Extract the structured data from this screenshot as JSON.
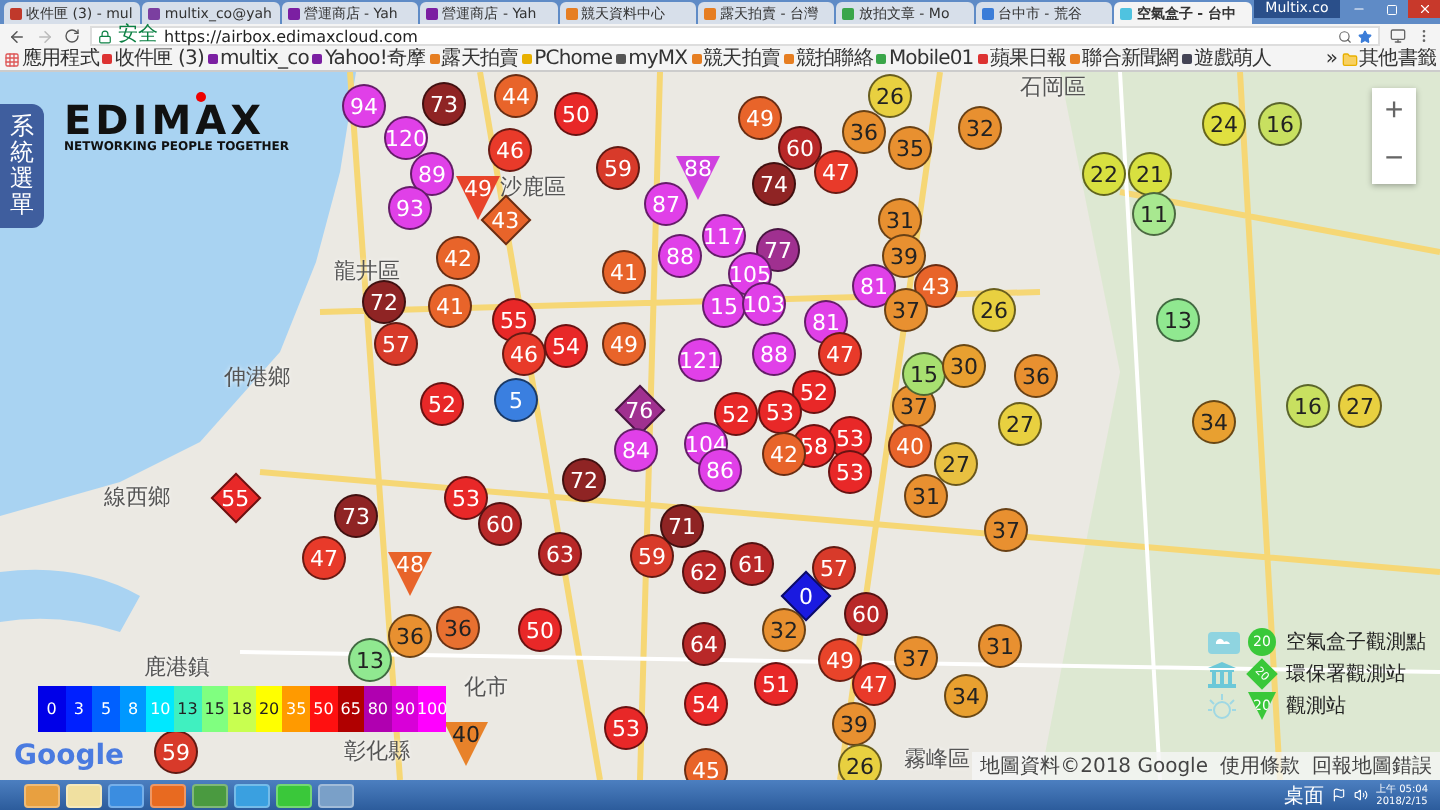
{
  "tabs": [
    {
      "label": "收件匣 (3) - mul",
      "selected": false
    },
    {
      "label": "multix_co@yah",
      "selected": false
    },
    {
      "label": "營運商店 - Yah",
      "selected": false
    },
    {
      "label": "營運商店 - Yah",
      "selected": false
    },
    {
      "label": "競天資料中心",
      "selected": false
    },
    {
      "label": "露天拍賣 - 台灣",
      "selected": false
    },
    {
      "label": "放拍文章 - Mo",
      "selected": false
    },
    {
      "label": "台中市 - 荒谷",
      "selected": false
    },
    {
      "label": "空氣盒子 - 台中",
      "selected": true
    }
  ],
  "user_badge": "Multix.co",
  "address": {
    "security": "安全",
    "url": "https://airbox.edimaxcloud.com"
  },
  "bookmarks": [
    "應用程式",
    "收件匣 (3)",
    "multix_co",
    "Yahoo!奇摩",
    "露天拍賣",
    "PChome",
    "myMX",
    "競天拍賣",
    "競拍聯絡",
    "Mobile01",
    "蘋果日報",
    "聯合新聞網",
    "遊戲萌人"
  ],
  "bookmarks_more": "»",
  "bookmarks_other": "其他書籤",
  "side_menu": "系統選單",
  "logo": {
    "name": "EDIMAX",
    "tagline": "NETWORKING PEOPLE TOGETHER"
  },
  "zoom": [
    "+",
    "−"
  ],
  "places": [
    "沙鹿區",
    "龍井區",
    "伸港鄉",
    "線西鄉",
    "鹿港鎮",
    "化市",
    "彰化縣",
    "霧峰區",
    "石岡區"
  ],
  "markers": [
    {
      "value": "94",
      "kind": "circle",
      "color": "#e040e8"
    },
    {
      "value": "73",
      "kind": "circle",
      "color": "#8f2424"
    },
    {
      "value": "120",
      "kind": "circle",
      "color": "#e040e8"
    },
    {
      "value": "89",
      "kind": "circle",
      "color": "#e040e8"
    },
    {
      "value": "93",
      "kind": "circle",
      "color": "#e040e8"
    },
    {
      "value": "49",
      "kind": "triangle",
      "color": "#e8442a"
    },
    {
      "value": "42",
      "kind": "circle",
      "color": "#e8642a"
    },
    {
      "value": "44",
      "kind": "circle",
      "color": "#e8642a"
    },
    {
      "value": "46",
      "kind": "circle",
      "color": "#e83a2a"
    },
    {
      "value": "50",
      "kind": "circle",
      "color": "#e82828"
    },
    {
      "value": "59",
      "kind": "circle",
      "color": "#d83a2a"
    },
    {
      "value": "88",
      "kind": "triangle",
      "color": "#d040e0"
    },
    {
      "value": "87",
      "kind": "circle",
      "color": "#e040e8"
    },
    {
      "value": "88",
      "kind": "circle",
      "color": "#e040e8"
    },
    {
      "value": "117",
      "kind": "circle",
      "color": "#e040e8"
    },
    {
      "value": "74",
      "kind": "circle",
      "color": "#8f2424"
    },
    {
      "value": "77",
      "kind": "circle",
      "color": "#a03090"
    },
    {
      "value": "49",
      "kind": "circle",
      "color": "#e8642a"
    },
    {
      "value": "60",
      "kind": "circle",
      "color": "#b82828"
    },
    {
      "value": "47",
      "kind": "circle",
      "color": "#e83a2a"
    },
    {
      "value": "26",
      "kind": "circle",
      "color": "#e8d040"
    },
    {
      "value": "36",
      "kind": "circle",
      "color": "#e89030"
    },
    {
      "value": "35",
      "kind": "circle",
      "color": "#e89030"
    },
    {
      "value": "32",
      "kind": "circle",
      "color": "#e89030"
    },
    {
      "value": "31",
      "kind": "circle",
      "color": "#e89030"
    },
    {
      "value": "39",
      "kind": "circle",
      "color": "#e89030"
    },
    {
      "value": "43",
      "kind": "circle",
      "color": "#e8642a"
    },
    {
      "value": "81",
      "kind": "circle",
      "color": "#e040e8"
    },
    {
      "value": "37",
      "kind": "circle",
      "color": "#e89030"
    },
    {
      "value": "43",
      "kind": "diamond",
      "color": "#e8642a"
    },
    {
      "value": "41",
      "kind": "circle",
      "color": "#e8642a"
    },
    {
      "value": "105",
      "kind": "circle",
      "color": "#e040e8"
    },
    {
      "value": "15",
      "kind": "circle",
      "color": "#e040e8"
    },
    {
      "value": "103",
      "kind": "circle",
      "color": "#e040e8"
    },
    {
      "value": "55",
      "kind": "circle",
      "color": "#e82828"
    },
    {
      "value": "46",
      "kind": "circle",
      "color": "#e83a2a"
    },
    {
      "value": "54",
      "kind": "circle",
      "color": "#e82828"
    },
    {
      "value": "49",
      "kind": "circle",
      "color": "#e8642a"
    },
    {
      "value": "5",
      "kind": "circle",
      "color": "#3a7fe0"
    },
    {
      "value": "121",
      "kind": "circle",
      "color": "#e040e8"
    },
    {
      "value": "88",
      "kind": "circle",
      "color": "#e040e8"
    },
    {
      "value": "81",
      "kind": "circle",
      "color": "#e040e8"
    },
    {
      "value": "47",
      "kind": "circle",
      "color": "#e83a2a"
    },
    {
      "value": "76",
      "kind": "diamond",
      "color": "#a03090"
    },
    {
      "value": "52",
      "kind": "circle",
      "color": "#e82828"
    },
    {
      "value": "52",
      "kind": "circle",
      "color": "#e82828"
    },
    {
      "value": "53",
      "kind": "circle",
      "color": "#e82828"
    },
    {
      "value": "84",
      "kind": "circle",
      "color": "#e040e8"
    },
    {
      "value": "104",
      "kind": "circle",
      "color": "#e040e8"
    },
    {
      "value": "86",
      "kind": "circle",
      "color": "#e040e8"
    },
    {
      "value": "53",
      "kind": "circle",
      "color": "#e82828"
    },
    {
      "value": "58",
      "kind": "circle",
      "color": "#e82828"
    },
    {
      "value": "42",
      "kind": "circle",
      "color": "#e8642a"
    },
    {
      "value": "53",
      "kind": "circle",
      "color": "#e82828"
    },
    {
      "value": "37",
      "kind": "circle",
      "color": "#e89030"
    },
    {
      "value": "40",
      "kind": "circle",
      "color": "#e8642a"
    },
    {
      "value": "15",
      "kind": "circle",
      "color": "#a8e070"
    },
    {
      "value": "72",
      "kind": "circle",
      "color": "#8f2424"
    },
    {
      "value": "41",
      "kind": "circle",
      "color": "#e8642a"
    },
    {
      "value": "57",
      "kind": "circle",
      "color": "#d83a2a"
    },
    {
      "value": "52",
      "kind": "circle",
      "color": "#e82828"
    },
    {
      "value": "72",
      "kind": "circle",
      "color": "#8f2424"
    },
    {
      "value": "73",
      "kind": "circle",
      "color": "#8f2424"
    },
    {
      "value": "53",
      "kind": "circle",
      "color": "#e82828"
    },
    {
      "value": "60",
      "kind": "circle",
      "color": "#b82828"
    },
    {
      "value": "55",
      "kind": "diamond",
      "color": "#e82828"
    },
    {
      "value": "47",
      "kind": "circle",
      "color": "#e83a2a"
    },
    {
      "value": "48",
      "kind": "triangle",
      "color": "#e8642a"
    },
    {
      "value": "63",
      "kind": "circle",
      "color": "#b82828"
    },
    {
      "value": "59",
      "kind": "circle",
      "color": "#d83a2a"
    },
    {
      "value": "71",
      "kind": "circle",
      "color": "#8f2424"
    },
    {
      "value": "62",
      "kind": "circle",
      "color": "#b82828"
    },
    {
      "value": "61",
      "kind": "circle",
      "color": "#b82828"
    },
    {
      "value": "57",
      "kind": "circle",
      "color": "#d83a2a"
    },
    {
      "value": "0",
      "kind": "diamond",
      "color": "#1a1ae0"
    },
    {
      "value": "32",
      "kind": "circle",
      "color": "#e89030"
    },
    {
      "value": "51",
      "kind": "circle",
      "color": "#e82828"
    },
    {
      "value": "49",
      "kind": "circle",
      "color": "#e8442a"
    },
    {
      "value": "60",
      "kind": "circle",
      "color": "#b82828"
    },
    {
      "value": "37",
      "kind": "circle",
      "color": "#e89030"
    },
    {
      "value": "47",
      "kind": "circle",
      "color": "#e83a2a"
    },
    {
      "value": "39",
      "kind": "circle",
      "color": "#e89030"
    },
    {
      "value": "26",
      "kind": "circle",
      "color": "#e8d040"
    },
    {
      "value": "31",
      "kind": "circle",
      "color": "#e89030"
    },
    {
      "value": "34",
      "kind": "circle",
      "color": "#e8a030"
    },
    {
      "value": "50",
      "kind": "circle",
      "color": "#e82828"
    },
    {
      "value": "64",
      "kind": "circle",
      "color": "#b82828"
    },
    {
      "value": "54",
      "kind": "circle",
      "color": "#e82828"
    },
    {
      "value": "53",
      "kind": "circle",
      "color": "#e82828"
    },
    {
      "value": "45",
      "kind": "circle",
      "color": "#e8642a"
    },
    {
      "value": "36",
      "kind": "circle",
      "color": "#e89030"
    },
    {
      "value": "36",
      "kind": "circle",
      "color": "#e87030"
    },
    {
      "value": "13",
      "kind": "circle",
      "color": "#90e890"
    },
    {
      "value": "59",
      "kind": "circle",
      "color": "#d83a2a"
    },
    {
      "value": "31",
      "kind": "circle",
      "color": "#e89030"
    },
    {
      "value": "37",
      "kind": "circle",
      "color": "#e89030"
    },
    {
      "value": "27",
      "kind": "circle",
      "color": "#e8c040"
    },
    {
      "value": "26",
      "kind": "circle",
      "color": "#e8d040"
    },
    {
      "value": "30",
      "kind": "circle",
      "color": "#e8a030"
    },
    {
      "value": "36",
      "kind": "circle",
      "color": "#e89030"
    },
    {
      "value": "27",
      "kind": "circle",
      "color": "#e8d040"
    },
    {
      "value": "13",
      "kind": "circle",
      "color": "#90e890"
    },
    {
      "value": "22",
      "kind": "circle",
      "color": "#d8e040"
    },
    {
      "value": "21",
      "kind": "circle",
      "color": "#d8e040"
    },
    {
      "value": "11",
      "kind": "circle",
      "color": "#a8e890"
    },
    {
      "value": "24",
      "kind": "circle",
      "color": "#e0e040"
    },
    {
      "value": "16",
      "kind": "circle",
      "color": "#c8e060"
    },
    {
      "value": "34",
      "kind": "circle",
      "color": "#e8a030"
    },
    {
      "value": "16",
      "kind": "circle",
      "color": "#c8e060"
    },
    {
      "value": "27",
      "kind": "circle",
      "color": "#e8d040"
    },
    {
      "value": "40",
      "kind": "triangle",
      "color": "#e8822a"
    }
  ],
  "scale": [
    {
      "label": "0",
      "color": "#0000e8"
    },
    {
      "label": "3",
      "color": "#0020ff"
    },
    {
      "label": "5",
      "color": "#0060ff"
    },
    {
      "label": "8",
      "color": "#0098ff"
    },
    {
      "label": "10",
      "color": "#00e8ff"
    },
    {
      "label": "13",
      "color": "#40f0c0"
    },
    {
      "label": "15",
      "color": "#80ff80"
    },
    {
      "label": "18",
      "color": "#c8ff50"
    },
    {
      "label": "20",
      "color": "#ffff00"
    },
    {
      "label": "35",
      "color": "#ff9a00"
    },
    {
      "label": "50",
      "color": "#ff1010"
    },
    {
      "label": "65",
      "color": "#b00000"
    },
    {
      "label": "80",
      "color": "#b000b0"
    },
    {
      "label": "90",
      "color": "#d800d8"
    },
    {
      "label": "100",
      "color": "#ff00ff"
    }
  ],
  "station_legend": [
    {
      "kind": "circle",
      "value": "20",
      "label": "空氣盒子觀測點"
    },
    {
      "kind": "diamond",
      "value": "20",
      "label": "環保署觀測站"
    },
    {
      "kind": "triangle",
      "value": "20",
      "label": "觀測站"
    }
  ],
  "map_footer": {
    "provider": "Google",
    "data": "地圖資料©2018 Google",
    "terms": "使用條款",
    "report": "回報地圖錯誤"
  },
  "tray": {
    "desktop": "桌面",
    "time": "上午 05:04",
    "date": "2018/2/15"
  }
}
